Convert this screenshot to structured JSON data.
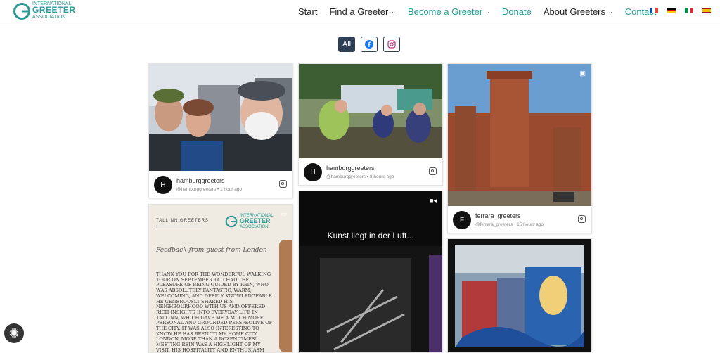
{
  "brand": {
    "line1": "INTERNATIONAL",
    "line2": "GREETER",
    "line3": "ASSOCIATION",
    "color": "#2a9a94"
  },
  "nav": [
    {
      "label": "Start",
      "dropdown": false,
      "accent": false
    },
    {
      "label": "Find a Greeter",
      "dropdown": true,
      "accent": false
    },
    {
      "label": "Become a Greeter",
      "dropdown": true,
      "accent": true
    },
    {
      "label": "Donate",
      "dropdown": false,
      "accent": true
    },
    {
      "label": "About Greeters",
      "dropdown": true,
      "accent": false
    },
    {
      "label": "Contact",
      "dropdown": false,
      "accent": true
    }
  ],
  "languages": [
    "fr",
    "de",
    "it",
    "es"
  ],
  "filters": {
    "all_label": "All",
    "facebook_icon": "facebook-icon",
    "instagram_icon": "instagram-icon"
  },
  "posts": [
    {
      "avatar": "H",
      "user": "hamburggreeters",
      "handle": "@hamburggreeters",
      "time": "1 hour ago"
    },
    {
      "avatar": "H",
      "user": "hamburggreeters",
      "handle": "@hamburggreeters",
      "time": "8 hours ago"
    },
    {
      "avatar": "F",
      "user": "ferrara_greeters",
      "handle": "@ferrara_greeters",
      "time": "15 hours ago"
    }
  ],
  "tallinn_post": {
    "header": "TALLINN GREETERS",
    "logo_line1": "INTERNATIONAL",
    "logo_line2": "GREETER",
    "logo_line3": "ASSOCIATION",
    "script_title": "Feedback from guest from London",
    "body": "THANK YOU FOR THE WONDERFUL WALKING TOUR ON SEPTEMBER 14. I HAD THE PLEASURE OF BEING GUIDED BY REIN, WHO WAS ABSOLUTELY FANTASTIC, WARM, WELCOMING, AND DEEPLY KNOWLEDGEABLE. HE GENEROUSLY SHARED HIS NEIGHBOURHOOD WITH US AND OFFERED RICH INSIGHTS INTO EVERYDAY LIFE IN TALLINN, WHICH GAVE ME A MUCH MORE PERSONAL AND GROUNDED PERSPECTIVE OF THE CITY. IT WAS ALSO INTERESTING TO KNOW HE HAS BEEN TO MY HOME CITY, LONDON, MORE THAN A DOZEN TIMES! MEETING REIN WAS A HIGHLIGHT OF MY VISIT. HIS HOSPITALITY AND ENTHUSIASM MADE THE EXPERIENCE FEEL LESS LIKE A WALK WITH AN OLDTHANK YOU FOR CREATING SUCH"
  },
  "video_post": {
    "caption": "Kunst liegt in der Luft..."
  }
}
